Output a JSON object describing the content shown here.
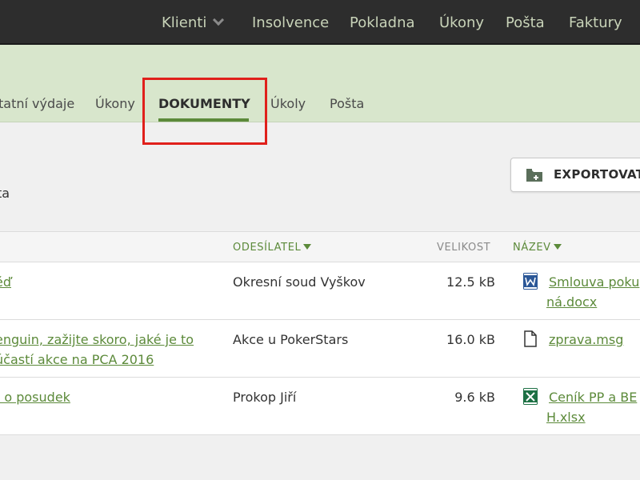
{
  "topnav": {
    "items": [
      "Klienti",
      "Insolvence",
      "Pokladna",
      "Úkony",
      "Pošta",
      "Faktury"
    ]
  },
  "subnav": {
    "tabs": [
      "tatní výdaje",
      "Úkony",
      "DOKUMENTY",
      "Úkoly",
      "Pošta"
    ],
    "active_tab": "DOKUMENTY"
  },
  "toolbar": {
    "export_label": "EXPORTOVAT"
  },
  "fragment_text": "ta",
  "table": {
    "columns": {
      "sender": "ODESÍLATEL",
      "size": "VELIKOST",
      "name": "NÁZEV"
    },
    "rows": [
      {
        "subject": "ěď",
        "sender": "Okresní soud Vyškov",
        "size": "12.5 kB",
        "file_icon": "word-doc-icon",
        "filename": "Smlouva pokutová.docx",
        "filename_display": "Smlouva poku ná.docx"
      },
      {
        "subject": "enguin, zažijte skoro, jaké je to účastí akce na PCA 2016",
        "sender": "Akce u PokerStars",
        "size": "16.0 kB",
        "file_icon": "message-file-icon",
        "filename": "zprava.msg",
        "filename_display": "zprava.msg"
      },
      {
        "subject": "t o posudek",
        "sender": "Prokop Jiří",
        "size": "9.6 kB",
        "file_icon": "excel-sheet-icon",
        "filename": "Ceník PP a BH.xlsx",
        "filename_display": "Ceník PP a BE H.xlsx"
      }
    ]
  },
  "colors": {
    "accent_green": "#5c8a3a",
    "topbar_bg": "#2d2d2d",
    "subnav_bg": "#d8e6cc",
    "highlight_red": "#e0201b"
  }
}
